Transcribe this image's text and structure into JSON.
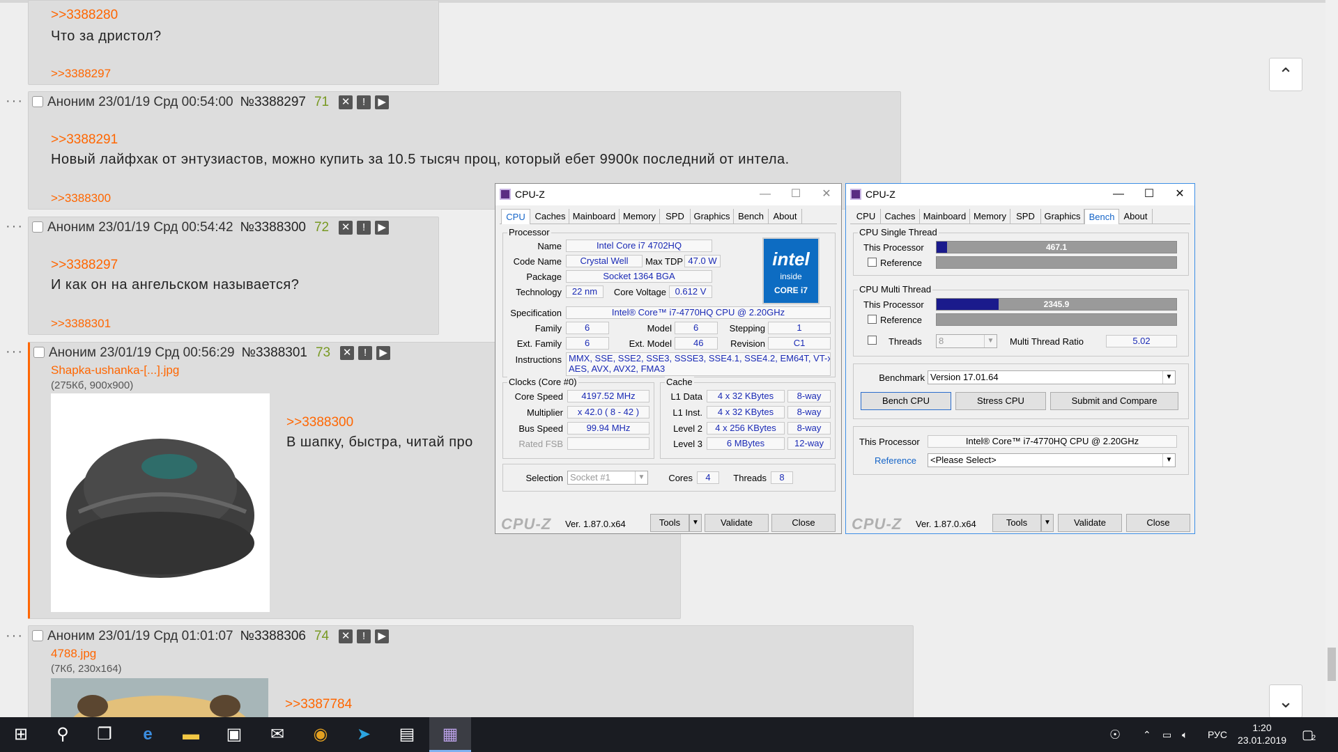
{
  "posts": [
    {
      "reply_to": ">>3388280",
      "text": "Что за дристол?",
      "backref": ">>3388297"
    },
    {
      "author": "Аноним",
      "date": "23/01/19 Срд 00:54:00",
      "number": "№3388297",
      "count": "71",
      "reply_to": ">>3388291",
      "text": "Новый лайфхак от энтузиастов, можно купить за 10.5 тысяч проц, который ебет 9900к последний от интела.",
      "backref": ">>3388300"
    },
    {
      "author": "Аноним",
      "date": "23/01/19 Срд 00:54:42",
      "number": "№3388300",
      "count": "72",
      "reply_to": ">>3388297",
      "text": "И как он на ангельском называется?",
      "backref": ">>3388301"
    },
    {
      "author": "Аноним",
      "date": "23/01/19 Срд 00:56:29",
      "number": "№3388301",
      "count": "73",
      "file": "Shapka-ushanka-[...].jpg",
      "file_info": "(275Кб, 900x900)",
      "reply_to": ">>3388300",
      "text": "В шапку, быстра, читай про"
    },
    {
      "author": "Аноним",
      "date": "23/01/19 Срд 01:01:07",
      "number": "№3388306",
      "count": "74",
      "file": "4788.jpg",
      "file_info": "(7Кб, 230x164)",
      "reply_to": ">>3387784"
    }
  ],
  "post_buttons": {
    "hide": "✕",
    "report": "!",
    "play": "▶"
  },
  "nav": {
    "up": "⌃",
    "down": "⌄"
  },
  "cpuz": {
    "title": "CPU-Z",
    "tabs": [
      "CPU",
      "Caches",
      "Mainboard",
      "Memory",
      "SPD",
      "Graphics",
      "Bench",
      "About"
    ],
    "version": "Ver. 1.87.0.x64",
    "logo": "CPU-Z",
    "tools": "Tools",
    "validate": "Validate",
    "close": "Close",
    "cpu": {
      "processor_label": "Processor",
      "name_label": "Name",
      "name": "Intel Core i7 4702HQ",
      "codename_label": "Code Name",
      "codename": "Crystal Well",
      "maxtdp_label": "Max TDP",
      "maxtdp": "47.0 W",
      "package_label": "Package",
      "package": "Socket 1364 BGA",
      "technology_label": "Technology",
      "technology": "22 nm",
      "voltage_label": "Core Voltage",
      "voltage": "0.612 V",
      "spec_label": "Specification",
      "spec": "Intel® Core™ i7-4770HQ CPU @ 2.20GHz",
      "family_label": "Family",
      "family": "6",
      "model_label": "Model",
      "model": "6",
      "stepping_label": "Stepping",
      "stepping": "1",
      "extfamily_label": "Ext. Family",
      "extfamily": "6",
      "extmodel_label": "Ext. Model",
      "extmodel": "46",
      "revision_label": "Revision",
      "revision": "C1",
      "instructions_label": "Instructions",
      "instructions_1": "MMX, SSE, SSE2, SSE3, SSSE3, SSE4.1, SSE4.2, EM64T, VT-x,",
      "instructions_2": "AES, AVX, AVX2, FMA3",
      "clocks_label": "Clocks (Core #0)",
      "corespeed_label": "Core Speed",
      "corespeed": "4197.52 MHz",
      "multiplier_label": "Multiplier",
      "multiplier": "x 42.0 ( 8 - 42 )",
      "busspeed_label": "Bus Speed",
      "busspeed": "99.94 MHz",
      "ratedfsb_label": "Rated FSB",
      "ratedfsb": "",
      "cache_label": "Cache",
      "l1data_label": "L1 Data",
      "l1data": "4 x 32 KBytes",
      "l1data_way": "8-way",
      "l1inst_label": "L1 Inst.",
      "l1inst": "4 x 32 KBytes",
      "l1inst_way": "8-way",
      "l2_label": "Level 2",
      "l2": "4 x 256 KBytes",
      "l2_way": "8-way",
      "l3_label": "Level 3",
      "l3": "6 MBytes",
      "l3_way": "12-way",
      "selection_label": "Selection",
      "selection": "Socket #1",
      "cores_label": "Cores",
      "cores": "4",
      "threads_label": "Threads",
      "threads": "8",
      "intel_brand": "intel",
      "intel_inside": "inside",
      "intel_core": "CORE i7"
    },
    "bench": {
      "single_label": "CPU Single Thread",
      "this_processor": "This Processor",
      "reference": "Reference",
      "single_value": "467.1",
      "single_fraction": 0.045,
      "multi_label": "CPU Multi Thread",
      "multi_value": "2345.9",
      "multi_fraction": 0.26,
      "threads_label": "Threads",
      "threads_value": "8",
      "ratio_label": "Multi Thread Ratio",
      "ratio": "5.02",
      "benchmark_label": "Benchmark",
      "benchmark_version": "Version 17.01.64",
      "bench_cpu": "Bench CPU",
      "stress_cpu": "Stress CPU",
      "submit": "Submit and Compare",
      "this_proc_label": "This Processor",
      "this_proc_name": "Intel® Core™ i7-4770HQ CPU @ 2.20GHz",
      "reference_label": "Reference",
      "reference_select": "<Please Select>"
    }
  },
  "taskbar": {
    "lang": "РУС",
    "time": "1:20",
    "date": "23.01.2019",
    "notifications": "2"
  },
  "colors": {
    "accent_orange": "#ff6600",
    "count_green": "#789922",
    "cpuz_blue": "#1a2ab5",
    "bench_bar": "#1a1a8c"
  }
}
